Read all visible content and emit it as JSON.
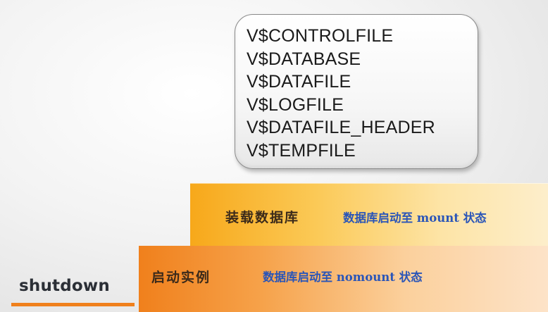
{
  "views": [
    "V$CONTROLFILE",
    "V$DATABASE",
    "V$DATAFILE",
    "V$LOGFILE",
    "V$DATAFILE_HEADER",
    "V$TEMPFILE"
  ],
  "steps": {
    "mount": {
      "stage": "装载数据库",
      "description": "数据库启动至 mount 状态"
    },
    "nomount": {
      "stage": "启动实例",
      "description": "数据库启动至 nomount 状态"
    }
  },
  "shutdown_label": "shutdown",
  "colors": {
    "mount_step": "#f7a81a",
    "nomount_step": "#f0801c",
    "description_text": "#2a55b8",
    "underline": "#f0801c"
  }
}
